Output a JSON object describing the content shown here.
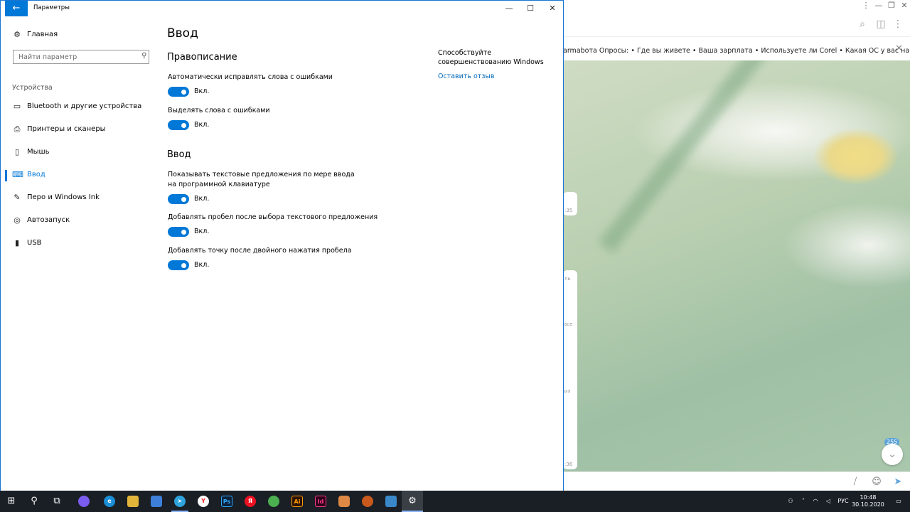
{
  "settings": {
    "window_title": "Параметры",
    "back_label": "←",
    "controls": {
      "minimize": "—",
      "maximize": "☐",
      "close": "✕"
    },
    "nav": {
      "home": "Главная",
      "search_placeholder": "Найти параметр",
      "section": "Устройства",
      "items": [
        {
          "label": "Bluetooth и другие устройства",
          "icon": "bluetooth-devices-icon"
        },
        {
          "label": "Принтеры и сканеры",
          "icon": "printer-icon"
        },
        {
          "label": "Мышь",
          "icon": "mouse-icon"
        },
        {
          "label": "Ввод",
          "icon": "keyboard-icon",
          "active": true
        },
        {
          "label": "Перо и Windows Ink",
          "icon": "pen-icon"
        },
        {
          "label": "Автозапуск",
          "icon": "autoplay-icon"
        },
        {
          "label": "USB",
          "icon": "usb-icon"
        }
      ]
    },
    "content": {
      "title": "Ввод",
      "spelling_section": "Правописание",
      "typing_section": "Ввод",
      "options": [
        {
          "label": "Автоматически исправлять слова с ошибками",
          "state": "Вкл.",
          "on": true
        },
        {
          "label": "Выделять слова с ошибками",
          "state": "Вкл.",
          "on": true
        },
        {
          "label": "Показывать текстовые предложения по мере ввода на программной клавиатуре",
          "state": "Вкл.",
          "on": true
        },
        {
          "label": "Добавлять пробел после выбора текстового предложения",
          "state": "Вкл.",
          "on": true
        },
        {
          "label": "Добавлять точку после двойного нажатия пробела",
          "state": "Вкл.",
          "on": true
        }
      ]
    },
    "aside": {
      "text": "Способствуйте совершенствованию Windows",
      "link": "Оставить отзыв"
    },
    "accent_color": "#0078d7"
  },
  "telegram": {
    "pinned_bar": "armabота  Опросы:  •  Где вы живете  •  Ваша зарплата  •  Используете ли Corel  •  Какая ОС у вас на компе  •  Яз",
    "unread_count": "255",
    "msg_time_1": ":35",
    "msg_time_2": ":36",
    "msg_fragment_1": "ль",
    "msg_fragment_2": "асе",
    "msg_fragment_3": "ых"
  },
  "taskbar": {
    "tray_lang": "РУС",
    "time": "10:48",
    "date": "30.10.2020"
  }
}
